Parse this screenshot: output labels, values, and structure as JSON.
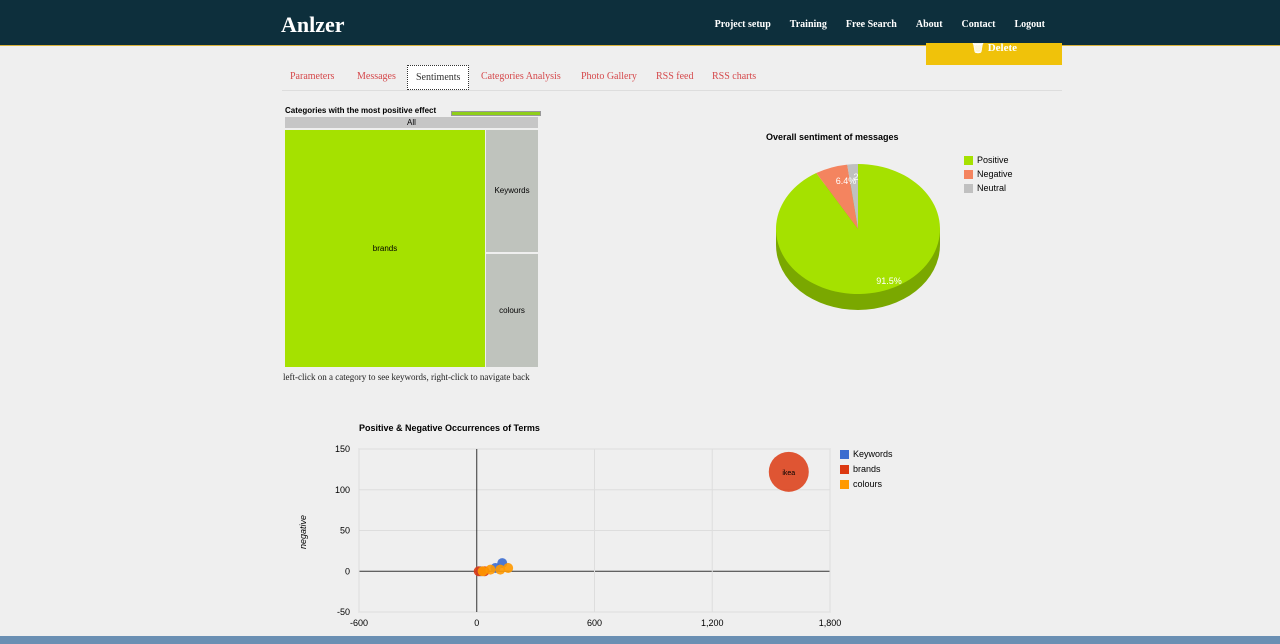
{
  "brand": "Anlzer",
  "nav": [
    "Project setup",
    "Training",
    "Free Search",
    "About",
    "Contact",
    "Logout"
  ],
  "delete_label": "🗑 Delete",
  "tabs": [
    "Parameters",
    "Messages",
    "Sentiments",
    "Categories Analysis",
    "Photo Gallery",
    "RSS feed",
    "RSS charts"
  ],
  "treemap": {
    "title": "Categories with the most positive effect",
    "root": "All",
    "cells": [
      "brands",
      "Keywords",
      "colours"
    ],
    "hint": "left-click on a category to see keywords, right-click to navigate back"
  },
  "pie": {
    "title": "Overall sentiment of messages",
    "labels": [
      "6.4%",
      "91.5%",
      "2"
    ],
    "legend": [
      "Positive",
      "Negative",
      "Neutral"
    ]
  },
  "scatter": {
    "title": "Positive & Negative Occurrences of Terms",
    "ylabel": "negative",
    "legend": [
      "Keywords",
      "brands",
      "colours"
    ],
    "yticks": [
      "150",
      "100",
      "50",
      "0",
      "-50"
    ],
    "xticks": [
      "-600",
      "0",
      "600",
      "1,200",
      "1,800"
    ],
    "bubble_label": "ikea"
  },
  "chart_data": [
    {
      "type": "pie",
      "title": "Overall sentiment of messages",
      "categories": [
        "Positive",
        "Negative",
        "Neutral"
      ],
      "values": [
        91.5,
        6.4,
        2.1
      ],
      "colors": [
        "#a5e100",
        "#f4845f",
        "#c0c0c0"
      ]
    },
    {
      "type": "scatter",
      "title": "Positive & Negative Occurrences of Terms",
      "ylabel": "negative",
      "xlim": [
        -600,
        1800
      ],
      "ylim": [
        -50,
        150
      ],
      "series": [
        {
          "name": "Keywords",
          "color": "#3b6ccf",
          "points": [
            {
              "x": 130,
              "y": 10
            },
            {
              "x": 95,
              "y": 4
            },
            {
              "x": 20,
              "y": 0
            }
          ]
        },
        {
          "name": "brands",
          "color": "#dc3912",
          "points": [
            {
              "x": 1590,
              "y": 122,
              "label": "ikea"
            },
            {
              "x": 40,
              "y": 0
            },
            {
              "x": 10,
              "y": 0
            }
          ]
        },
        {
          "name": "colours",
          "color": "#ff9900",
          "points": [
            {
              "x": 160,
              "y": 4
            },
            {
              "x": 70,
              "y": 2
            },
            {
              "x": 120,
              "y": 2
            },
            {
              "x": 30,
              "y": 0
            }
          ]
        }
      ]
    }
  ]
}
